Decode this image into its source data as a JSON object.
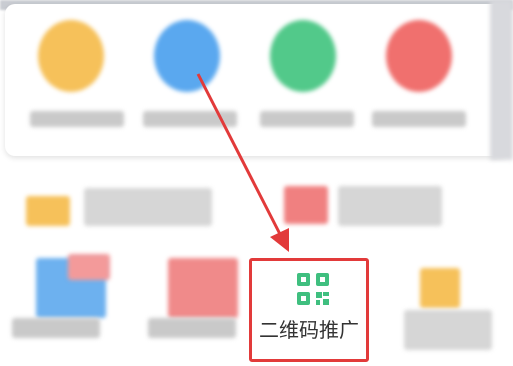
{
  "promo_tile": {
    "label": "二维码推广",
    "icon": "qr-code-icon"
  },
  "colors": {
    "highlight": "#e23a3a",
    "icon_green": "#3fbf7f",
    "tile_yellow": "#f6c15a",
    "tile_blue": "#5aa8ef",
    "tile_green": "#52c98a",
    "tile_red": "#f0706e"
  }
}
